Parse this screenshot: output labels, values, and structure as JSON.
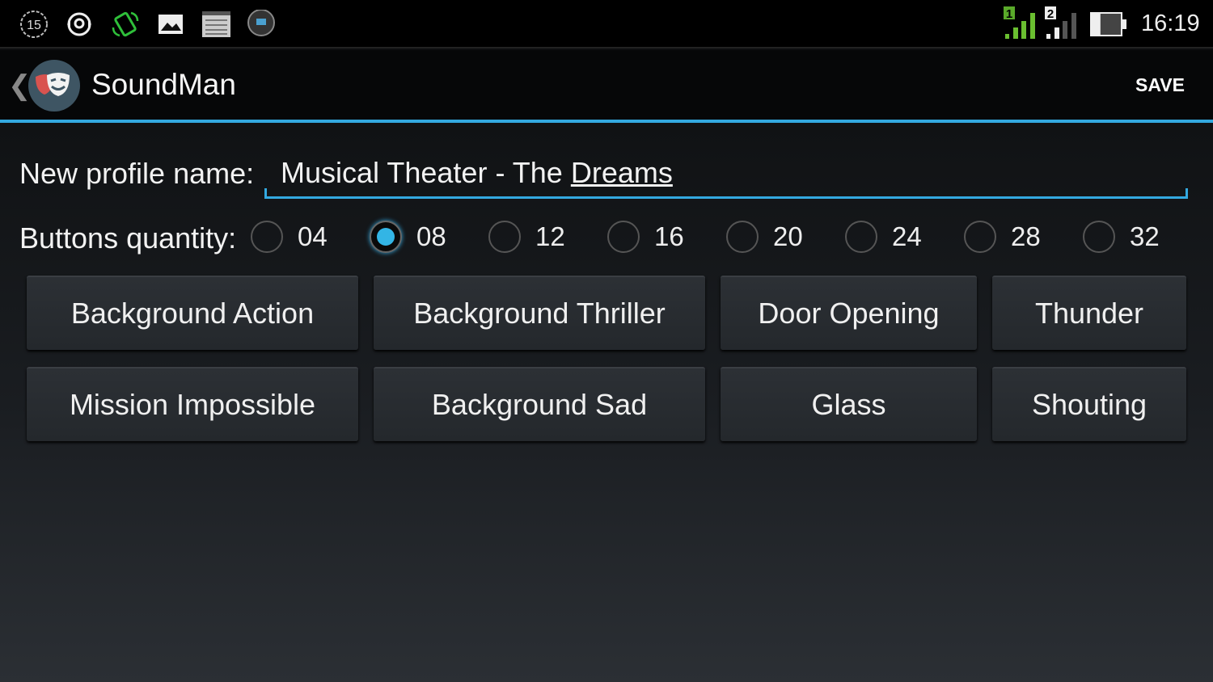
{
  "status_bar": {
    "notification_icons": [
      "badge-15-icon",
      "sync-icon",
      "screen-rotate-icon",
      "image-icon",
      "notes-icon",
      "camera-ball-icon"
    ],
    "badge_number": "15",
    "sim1_label": "1",
    "sim2_label": "2",
    "battery_level_percent": 30,
    "time": "16:19"
  },
  "action_bar": {
    "title": "SoundMan",
    "save_label": "SAVE",
    "accent_color": "#33a9e0"
  },
  "form": {
    "profile_name_label": "New profile name:",
    "profile_name_value_plain": "Musical Theater - The ",
    "profile_name_value_underlined": "Dreams",
    "buttons_quantity_label": "Buttons quantity:",
    "quantity_options": [
      "04",
      "08",
      "12",
      "16",
      "20",
      "24",
      "28",
      "32"
    ],
    "selected_quantity": "08"
  },
  "sound_buttons": [
    "Background Action",
    "Background Thriller",
    "Door Opening",
    "Thunder",
    "Mission Impossible",
    "Background Sad",
    "Glass",
    "Shouting"
  ]
}
